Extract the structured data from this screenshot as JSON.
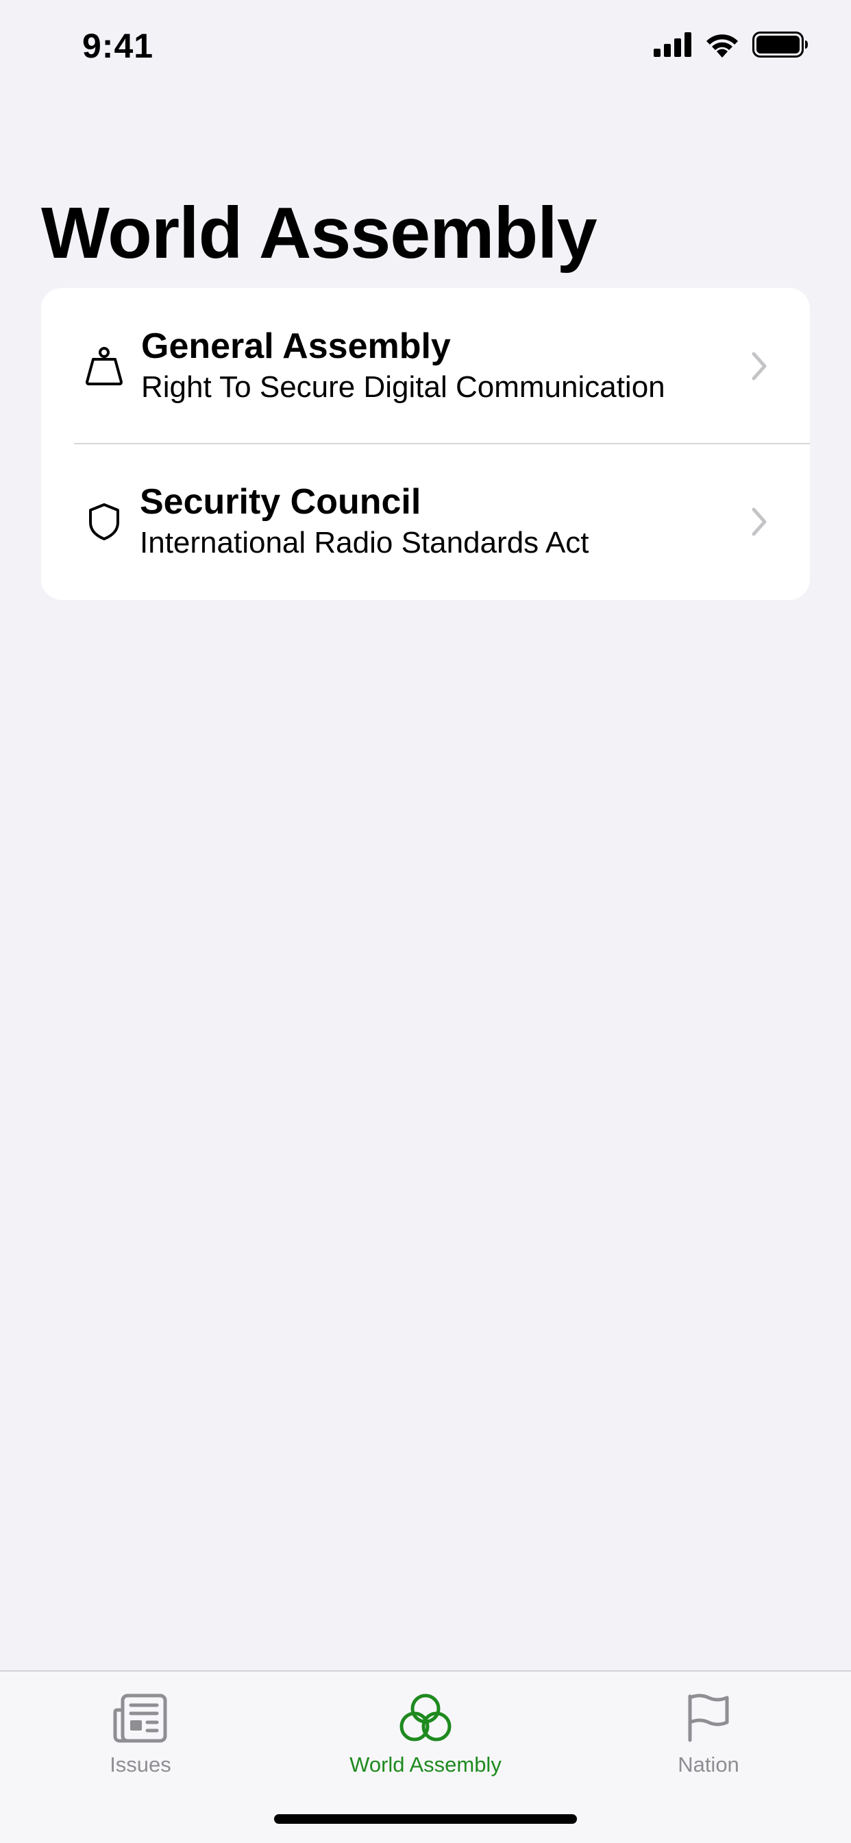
{
  "status_bar": {
    "time": "9:41"
  },
  "page": {
    "title": "World Assembly"
  },
  "list": {
    "items": [
      {
        "icon": "kettlebell-icon",
        "title": "General Assembly",
        "subtitle": "Right To Secure Digital Communication"
      },
      {
        "icon": "shield-icon",
        "title": "Security Council",
        "subtitle": "International Radio Standards Act"
      }
    ]
  },
  "tab_bar": {
    "tabs": [
      {
        "label": "Issues",
        "icon": "newspaper-icon",
        "active": false
      },
      {
        "label": "World Assembly",
        "icon": "three-circles-icon",
        "active": true
      },
      {
        "label": "Nation",
        "icon": "flag-icon",
        "active": false
      }
    ]
  },
  "colors": {
    "accent": "#1E8A1E",
    "background": "#F2F2F7",
    "inactive": "#8E8E93"
  }
}
